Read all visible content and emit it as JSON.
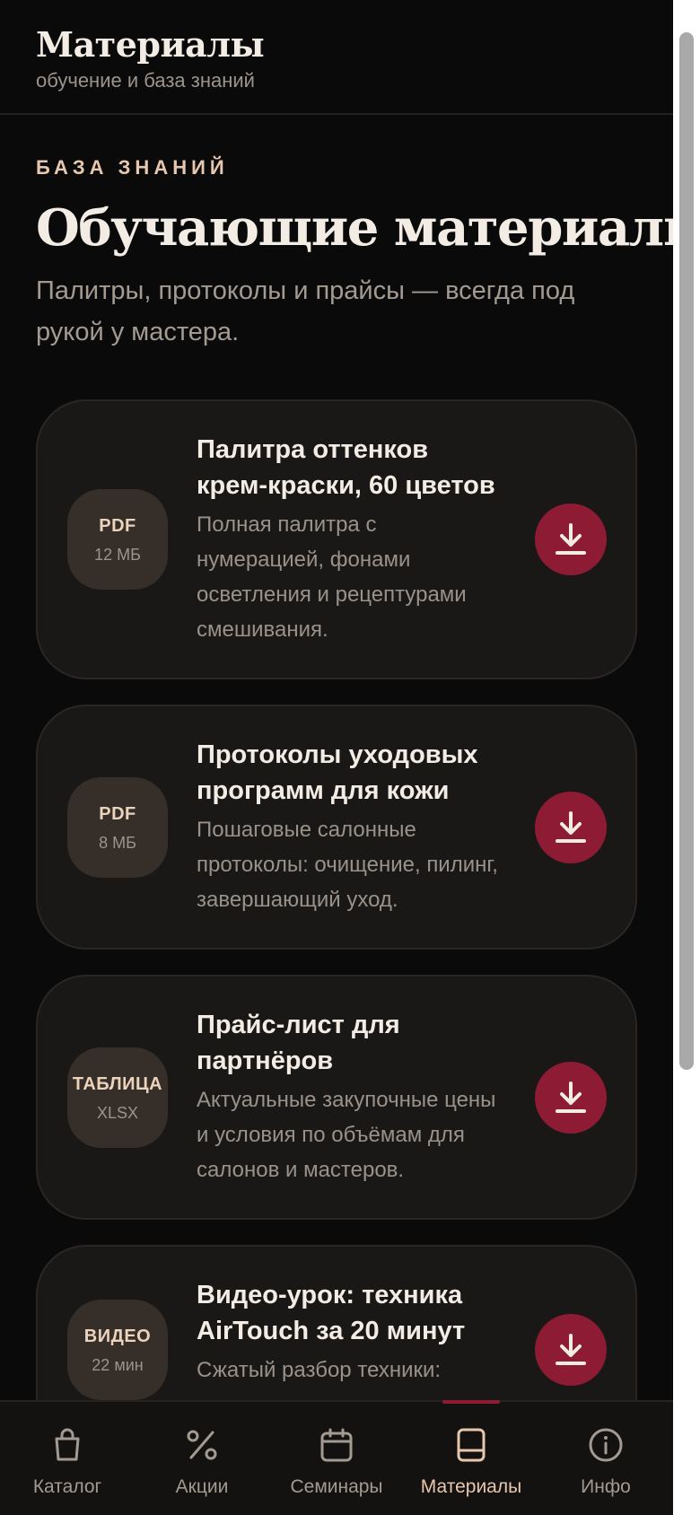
{
  "header": {
    "title": "Материалы",
    "subtitle": "обучение и база знаний"
  },
  "hero": {
    "eyebrow": "БАЗА ЗНАНИЙ",
    "title": "Обучающие материалы",
    "description": "Палитры, протоколы и прайсы — всегда под рукой у мастера."
  },
  "materials": [
    {
      "badge_type": "PDF",
      "badge_meta": "12 МБ",
      "title": "Палитра оттенков крем-краски, 60 цветов",
      "description": "Полная палитра с нумерацией, фонами осветления и рецептурами смешивания."
    },
    {
      "badge_type": "PDF",
      "badge_meta": "8 МБ",
      "title": "Протоколы уходовых программ для кожи",
      "description": "Пошаговые салонные протоколы: очищение, пилинг, завершающий уход."
    },
    {
      "badge_type": "ТАБЛИЦА",
      "badge_meta": "XLSX",
      "title": "Прайс-лист для партнёров",
      "description": "Актуальные закупочные цены и условия по объёмам для салонов и мастеров."
    },
    {
      "badge_type": "ВИДЕО",
      "badge_meta": "22 мин",
      "title": "Видео-урок: техника AirTouch за 20 минут",
      "description": "Сжатый разбор техники: разделение, выдувание,"
    }
  ],
  "nav": {
    "items": [
      {
        "label": "Каталог",
        "icon": "shopping-bag-icon",
        "active": false
      },
      {
        "label": "Акции",
        "icon": "percent-icon",
        "active": false
      },
      {
        "label": "Семинары",
        "icon": "calendar-icon",
        "active": false
      },
      {
        "label": "Материалы",
        "icon": "book-icon",
        "active": true
      },
      {
        "label": "Инфо",
        "icon": "info-icon",
        "active": false
      }
    ]
  },
  "colors": {
    "background": "#0b0a0a",
    "card": "#1a1816",
    "accent": "#8e1b34",
    "gold": "#e7c8ae"
  }
}
